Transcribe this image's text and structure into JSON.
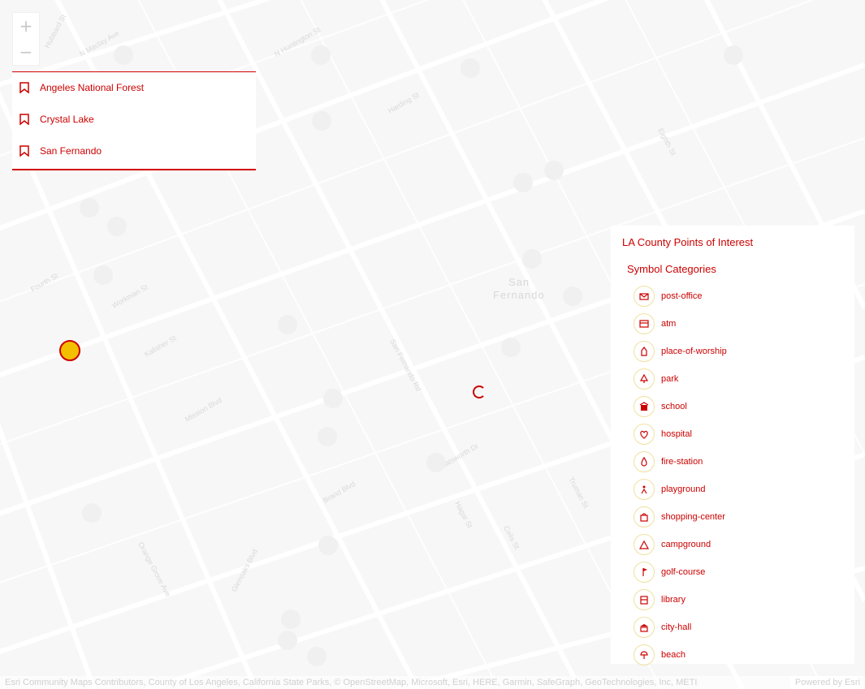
{
  "zoom": {
    "in_label": "+",
    "out_label": "−"
  },
  "bookmarks": [
    {
      "label": "Angeles National Forest"
    },
    {
      "label": "Crystal Lake"
    },
    {
      "label": "San Fernando"
    }
  ],
  "map": {
    "city_label": [
      "San",
      "Fernando"
    ],
    "road_labels": [
      "Hubbard St",
      "N Maclay Ave",
      "Harding St",
      "N Huntington St",
      "Fourth St",
      "Kalisher St",
      "Mission Blvd",
      "San Fernando Rd",
      "Brand Blvd",
      "Chatsworth Dr",
      "Workman St",
      "Truman St",
      "Glenoaks Blvd",
      "Hagar St",
      "Eighth St",
      "Celis St",
      "Orange Grove Ave"
    ]
  },
  "legend": {
    "title": "LA County Points of Interest",
    "subtitle": "Symbol Categories",
    "items": [
      {
        "label": "post-office",
        "icon": "post-office-icon"
      },
      {
        "label": "atm",
        "icon": "atm-icon"
      },
      {
        "label": "place-of-worship",
        "icon": "place-of-worship-icon"
      },
      {
        "label": "park",
        "icon": "park-icon"
      },
      {
        "label": "school",
        "icon": "school-icon"
      },
      {
        "label": "hospital",
        "icon": "hospital-icon"
      },
      {
        "label": "fire-station",
        "icon": "fire-station-icon"
      },
      {
        "label": "playground",
        "icon": "playground-icon"
      },
      {
        "label": "shopping-center",
        "icon": "shopping-center-icon"
      },
      {
        "label": "campground",
        "icon": "campground-icon"
      },
      {
        "label": "golf-course",
        "icon": "golf-course-icon"
      },
      {
        "label": "library",
        "icon": "library-icon"
      },
      {
        "label": "city-hall",
        "icon": "city-hall-icon"
      },
      {
        "label": "beach",
        "icon": "beach-icon"
      }
    ]
  },
  "attribution": {
    "text": "Esri Community Maps Contributors, County of Los Angeles, California State Parks, © OpenStreetMap, Microsoft, Esri, HERE, Garmin, SafeGraph, GeoTechnologies, Inc, METI",
    "powered": "Powered by Esri"
  },
  "colors": {
    "accent": "#cc0000",
    "symbol_ring": "#f1e0a0",
    "background": "#f7f7f7"
  }
}
